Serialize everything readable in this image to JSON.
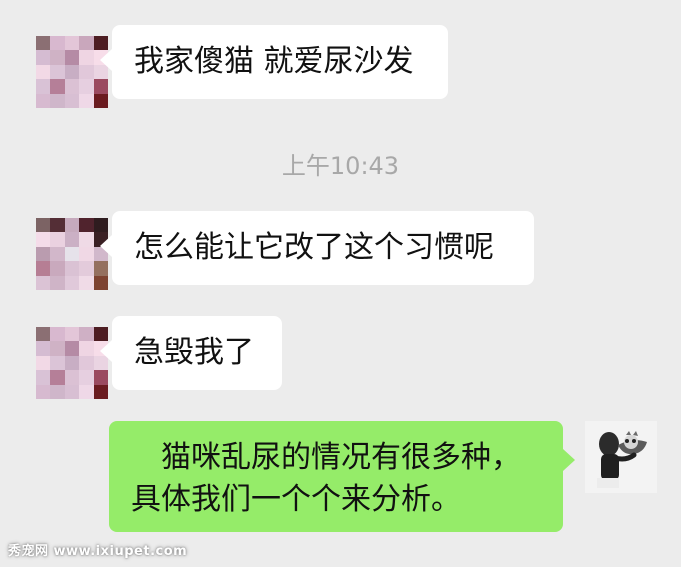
{
  "conversation": {
    "messages": [
      {
        "side": "incoming",
        "text": "我家傻猫 就爱尿沙发"
      },
      {
        "side": "incoming",
        "text": "怎么能让它改了这个习惯呢"
      },
      {
        "side": "incoming",
        "text": "急毁我了"
      },
      {
        "side": "outgoing",
        "lines": [
          "　猫咪乱尿的情况有很多种，",
          "具体我们一个个来分析。"
        ]
      }
    ],
    "timestamp": "上午10:43"
  },
  "watermark": {
    "brand": "秀宠网",
    "url": "www.ixiupet.com"
  },
  "colors": {
    "background": "#ececec",
    "incoming_bubble": "#ffffff",
    "outgoing_bubble": "#95ec69",
    "timestamp_text": "#a8a8a8"
  },
  "avatar_pixel_colors": [
    "#8b6f73",
    "#d8b8cf",
    "#e3c6d8",
    "#ffd8ea",
    "#6b1b20",
    "#d5bcd2",
    "#cfb2c5",
    "#b58ba5",
    "#efd5e3",
    "#f7dde9",
    "#f2d9e6",
    "#dbc4d7",
    "#c8aec4",
    "#e1c8da",
    "#ead4e2",
    "#d9c2d6",
    "#b57f98",
    "#dbc1d4",
    "#e6cfe0",
    "#9b4a60",
    "#d7bad0",
    "#cfb6ca",
    "#d8bfd3",
    "#efd8e7",
    "#6b1b20"
  ],
  "icons": {
    "incoming_avatar": "mosaic-avatar-icon",
    "outgoing_avatar": "user-holding-pet-icon"
  }
}
